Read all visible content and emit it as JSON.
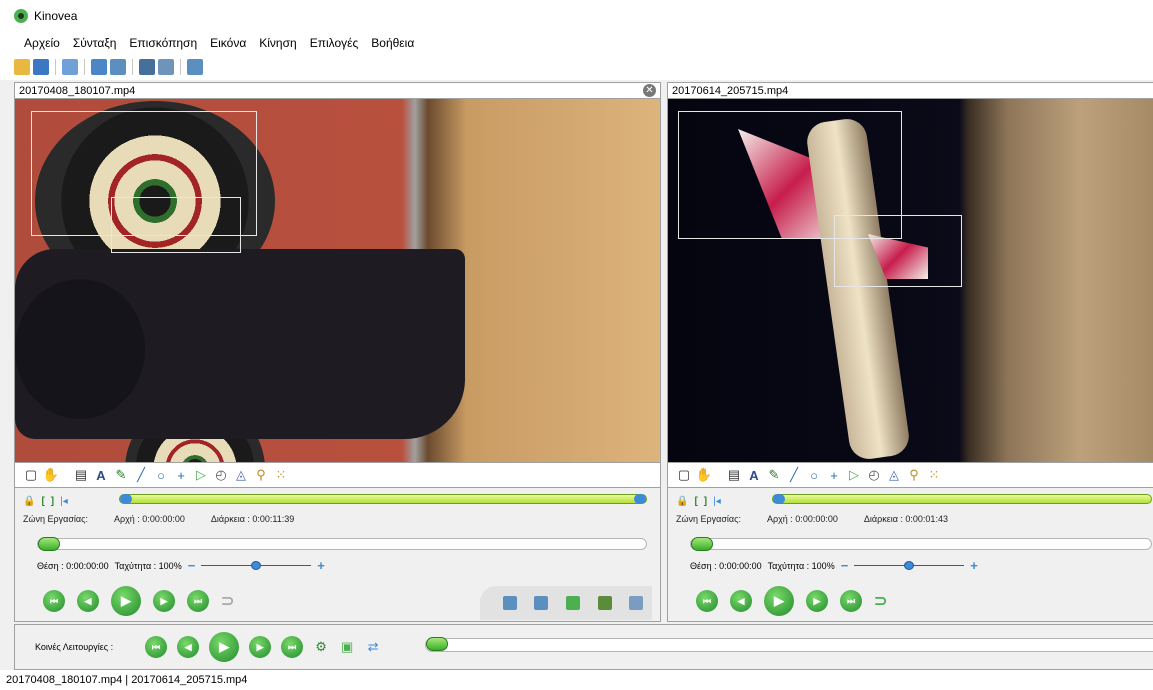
{
  "window": {
    "title": "Kinovea"
  },
  "menu": [
    "Αρχείο",
    "Σύνταξη",
    "Επισκόπηση",
    "Εικόνα",
    "Κίνηση",
    "Επιλογές",
    "Βοήθεια"
  ],
  "toolbar": {
    "icons": [
      "folder-open-icon",
      "save-icon",
      "single-screen-icon",
      "dual-screen-icon",
      "capture-icon",
      "capture-dual-icon",
      "settings-icon",
      "export-icon"
    ]
  },
  "panels": {
    "left": {
      "filename": "20170408_180107.mp4",
      "workzone_label": "Ζώνη Εργασίας:",
      "start": "Αρχή : 0:00:00:00",
      "duration": "Διάρκεια : 0:00:11:39",
      "position": "Θέση : 0:00:00:00",
      "speed": "Ταχύτητα : 100%",
      "speed_percent": 100
    },
    "right": {
      "filename": "20170614_205715.mp4",
      "workzone_label": "Ζώνη Εργασίας:",
      "start": "Αρχή : 0:00:00:00",
      "duration": "Διάρκεια : 0:00:01:43",
      "position": "Θέση : 0:00:00:00",
      "speed": "Ταχύτητα : 100%",
      "speed_percent": 100
    }
  },
  "common": {
    "label": "Κοινές Λειτουργίες :"
  },
  "status": {
    "text": "20170408_180107.mp4 | 20170614_205715.mp4"
  },
  "colors": {
    "accent_green": "#3aae2a",
    "workzone": "#b4e23a",
    "cursor_blue": "#3c8bd9"
  }
}
